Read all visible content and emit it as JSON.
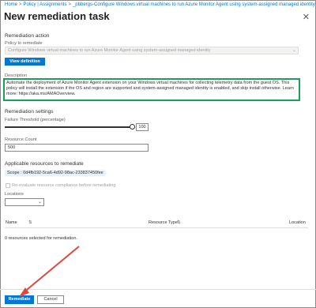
{
  "breadcrumb": {
    "items": [
      "Home",
      "Policy | Assignments",
      "_pbbergs-Configure Windows virtual machines to run Azure Monitor Agent using system-assigned managed identity"
    ]
  },
  "page": {
    "title": "New remediation task"
  },
  "remediation_action": {
    "heading": "Remediation action",
    "policy_label": "Policy to remediate",
    "policy_value": "Configure Windows virtual machines to run Azure Monitor Agent using system-assigned managed identity",
    "view_definition": "View definition"
  },
  "description": {
    "label": "Description",
    "text": "Automate the deployment of Azure Monitor Agent extension on your Windows virtual machines for collecting telemetry data from the guest OS. This policy will install the extension if the OS and region are supported and system-assigned managed identity is enabled, and skip install otherwise. Learn more: https://aka.ms/AMAOverview."
  },
  "settings": {
    "heading": "Remediation settings",
    "failure_label": "Failure Threshold (percentage)",
    "failure_value": "100",
    "failure_fraction": 1.0,
    "resource_count_label": "Resource Count",
    "resource_count_value": "500"
  },
  "applicable": {
    "heading": "Applicable resources to remediate",
    "scope": "Scope : 0d4fb192-5ca6-4d92-98ac-233837450fee",
    "reevaluate_label": "Re-evaluate resource compliance before remediating",
    "locations_label": "Locations",
    "locations_value": ""
  },
  "table": {
    "columns": [
      "Name",
      "Resource Type",
      "Location"
    ],
    "status": "0 resources selected for remediation."
  },
  "footer": {
    "remediate": "Remediate",
    "cancel": "Cancel"
  },
  "colors": {
    "accent": "#0078d4",
    "description_border": "#1aa05a",
    "arrow": "#e0463c"
  },
  "icons": [
    "close-icon",
    "chevron-down-icon",
    "sort-icon",
    "checkbox-icon"
  ]
}
